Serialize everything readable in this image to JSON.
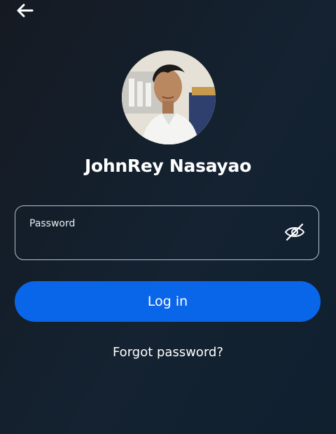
{
  "header": {
    "back_icon": "arrow-left-icon"
  },
  "profile": {
    "name": "JohnRey Nasayao",
    "avatar_icon": "profile-photo"
  },
  "password_field": {
    "label": "Password",
    "value": "",
    "toggle_icon": "eye-off-icon"
  },
  "actions": {
    "login_label": "Log in",
    "forgot_label": "Forgot password?"
  },
  "colors": {
    "primary": "#0a66e8",
    "background": "#142231"
  }
}
